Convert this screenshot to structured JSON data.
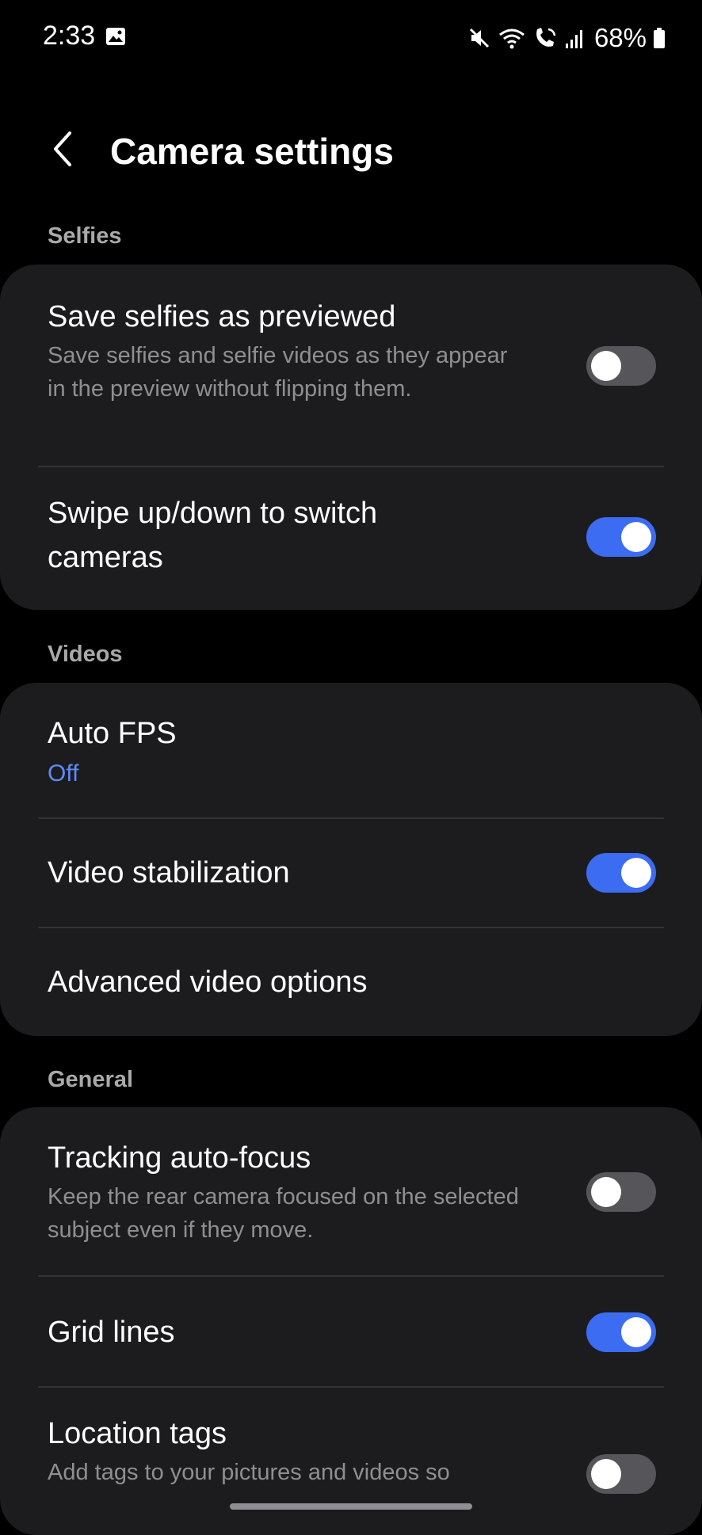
{
  "status_bar": {
    "time": "2:33",
    "battery": "68%",
    "icons": [
      "gallery-icon",
      "mute-icon",
      "wifi-icon",
      "wifi-calling-icon",
      "signal-icon",
      "battery-icon"
    ]
  },
  "header": {
    "title": "Camera settings",
    "back_icon": "chevron-left-icon"
  },
  "sections": {
    "selfies": {
      "label": "Selfies",
      "save_selfies": {
        "title": "Save selfies as previewed",
        "desc": "Save selfies and selfie videos as they appear in the preview without flipping them.",
        "enabled": false
      },
      "swipe_switch": {
        "title": "Swipe up/down to switch cameras",
        "enabled": true
      }
    },
    "videos": {
      "label": "Videos",
      "auto_fps": {
        "title": "Auto FPS",
        "value": "Off"
      },
      "video_stabilization": {
        "title": "Video stabilization",
        "enabled": true
      },
      "advanced_video": {
        "title": "Advanced video options"
      }
    },
    "general": {
      "label": "General",
      "tracking_af": {
        "title": "Tracking auto-focus",
        "desc": "Keep the rear camera focused on the selected subject even if they move.",
        "enabled": false
      },
      "grid_lines": {
        "title": "Grid lines",
        "enabled": true
      },
      "location_tags": {
        "title": "Location tags",
        "desc": "Add tags to your pictures and videos so",
        "enabled": false
      }
    }
  },
  "colors": {
    "background": "#000000",
    "card": "#1c1c1e",
    "accent": "#3c6cf2",
    "value_text": "#5e8af7",
    "secondary_text": "#8f8f93",
    "toggle_off": "#56565a"
  }
}
